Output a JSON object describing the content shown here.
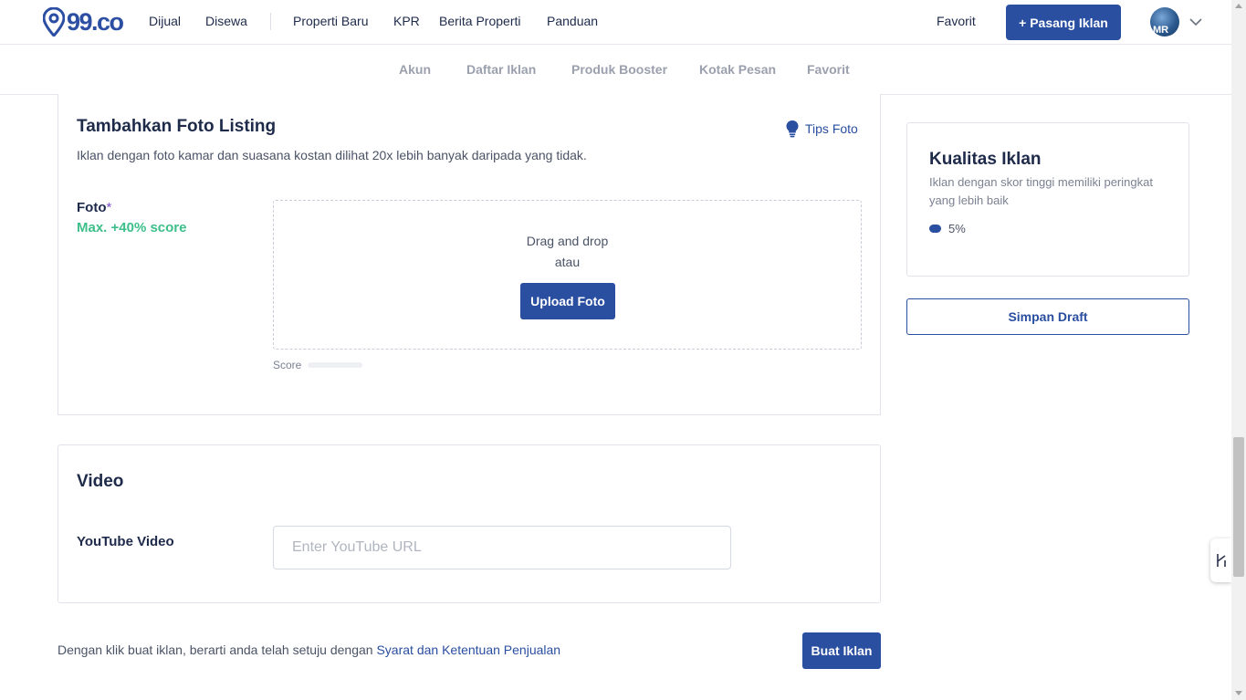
{
  "header": {
    "logo_text": "99.co",
    "nav_links": [
      "Dijual",
      "Disewa",
      "Properti Baru",
      "KPR",
      "Berita Properti",
      "Panduan"
    ],
    "favorit": "Favorit",
    "pasang_iklan": "+ Pasang Iklan",
    "avatar_initials": "MR"
  },
  "subnav": {
    "items": [
      "Akun",
      "Daftar Iklan",
      "Produk Booster",
      "Kotak Pesan",
      "Favorit"
    ]
  },
  "foto_section": {
    "title": "Tambahkan Foto Listing",
    "tips": "Tips Foto",
    "description": "Iklan dengan foto kamar dan suasana kostan dilihat 20x lebih banyak daripada yang tidak.",
    "field_label": "Foto",
    "required_mark": "*",
    "max_score": "Max. +40% score",
    "drag_drop": "Drag and drop",
    "atau": "atau",
    "upload_button": "Upload Foto",
    "score_label": "Score",
    "score_value": 0
  },
  "video_section": {
    "title": "Video",
    "field_label": "YouTube Video",
    "placeholder": "Enter YouTube URL",
    "value": ""
  },
  "footer": {
    "agree_text": "Dengan klik buat iklan, berarti anda telah setuju dengan ",
    "agree_link": "Syarat dan Ketentuan Penjualan",
    "submit": "Buat Iklan"
  },
  "sidebar": {
    "quality_title": "Kualitas Iklan",
    "quality_desc": "Iklan dengan skor tinggi memiliki peringkat yang lebih baik",
    "quality_score": "5%",
    "save_draft": "Simpan Draft"
  },
  "colors": {
    "primary": "#2a4ea0",
    "accent_green": "#3dbf8a",
    "required_purple": "#7b4fd1"
  },
  "icons": {
    "logo": "location-pin-icon",
    "tips": "lightbulb-icon",
    "avatar_menu": "chevron-down-icon",
    "floating": "chat-widget-icon"
  }
}
